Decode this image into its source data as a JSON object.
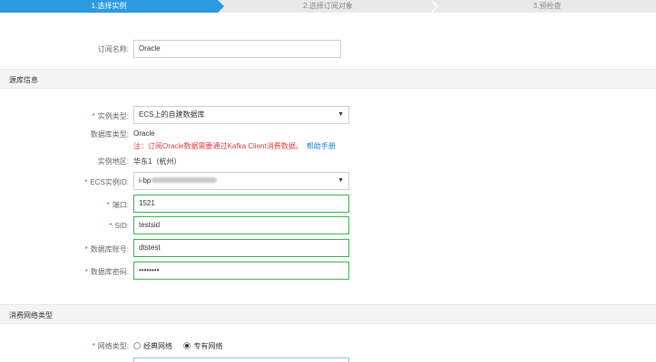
{
  "steps": {
    "step1": "1.选择实例",
    "step2": "2.选择订阅对象",
    "step3": "3.预检查"
  },
  "subscription": {
    "name_label": "订阅名称:",
    "name_value": "Oracle"
  },
  "source_section": {
    "title": "源库信息"
  },
  "fields": {
    "instance_type_label": "实例类型:",
    "instance_type_value": "ECS上的自建数据库",
    "db_type_label": "数据库类型:",
    "db_type_value": "Oracle",
    "warning_text": "注：订阅Oracle数据需要通过Kafka Client消费数据。",
    "help_link": "帮助手册",
    "region_label": "实例地区:",
    "region_value": "华东1（杭州）",
    "ecs_id_label": "ECS实例ID:",
    "ecs_id_value": "i-bp",
    "port_label": "端口:",
    "port_value": "1521",
    "sid_label": "SID:",
    "sid_value": "testsid",
    "account_label": "数据库账号:",
    "account_value": "dtstest",
    "password_label": "数据库密码:",
    "password_value": "••••••••"
  },
  "network_section": {
    "title": "消费网络类型"
  },
  "network": {
    "label": "网络类型:",
    "option_classic": "经典网络",
    "option_vpc": "专有网络",
    "selected": "专有网络"
  },
  "colors": {
    "accent": "#2b9ae0",
    "required": "#e4393c",
    "valid_border": "#37b34a",
    "link": "#1b7fd6"
  }
}
